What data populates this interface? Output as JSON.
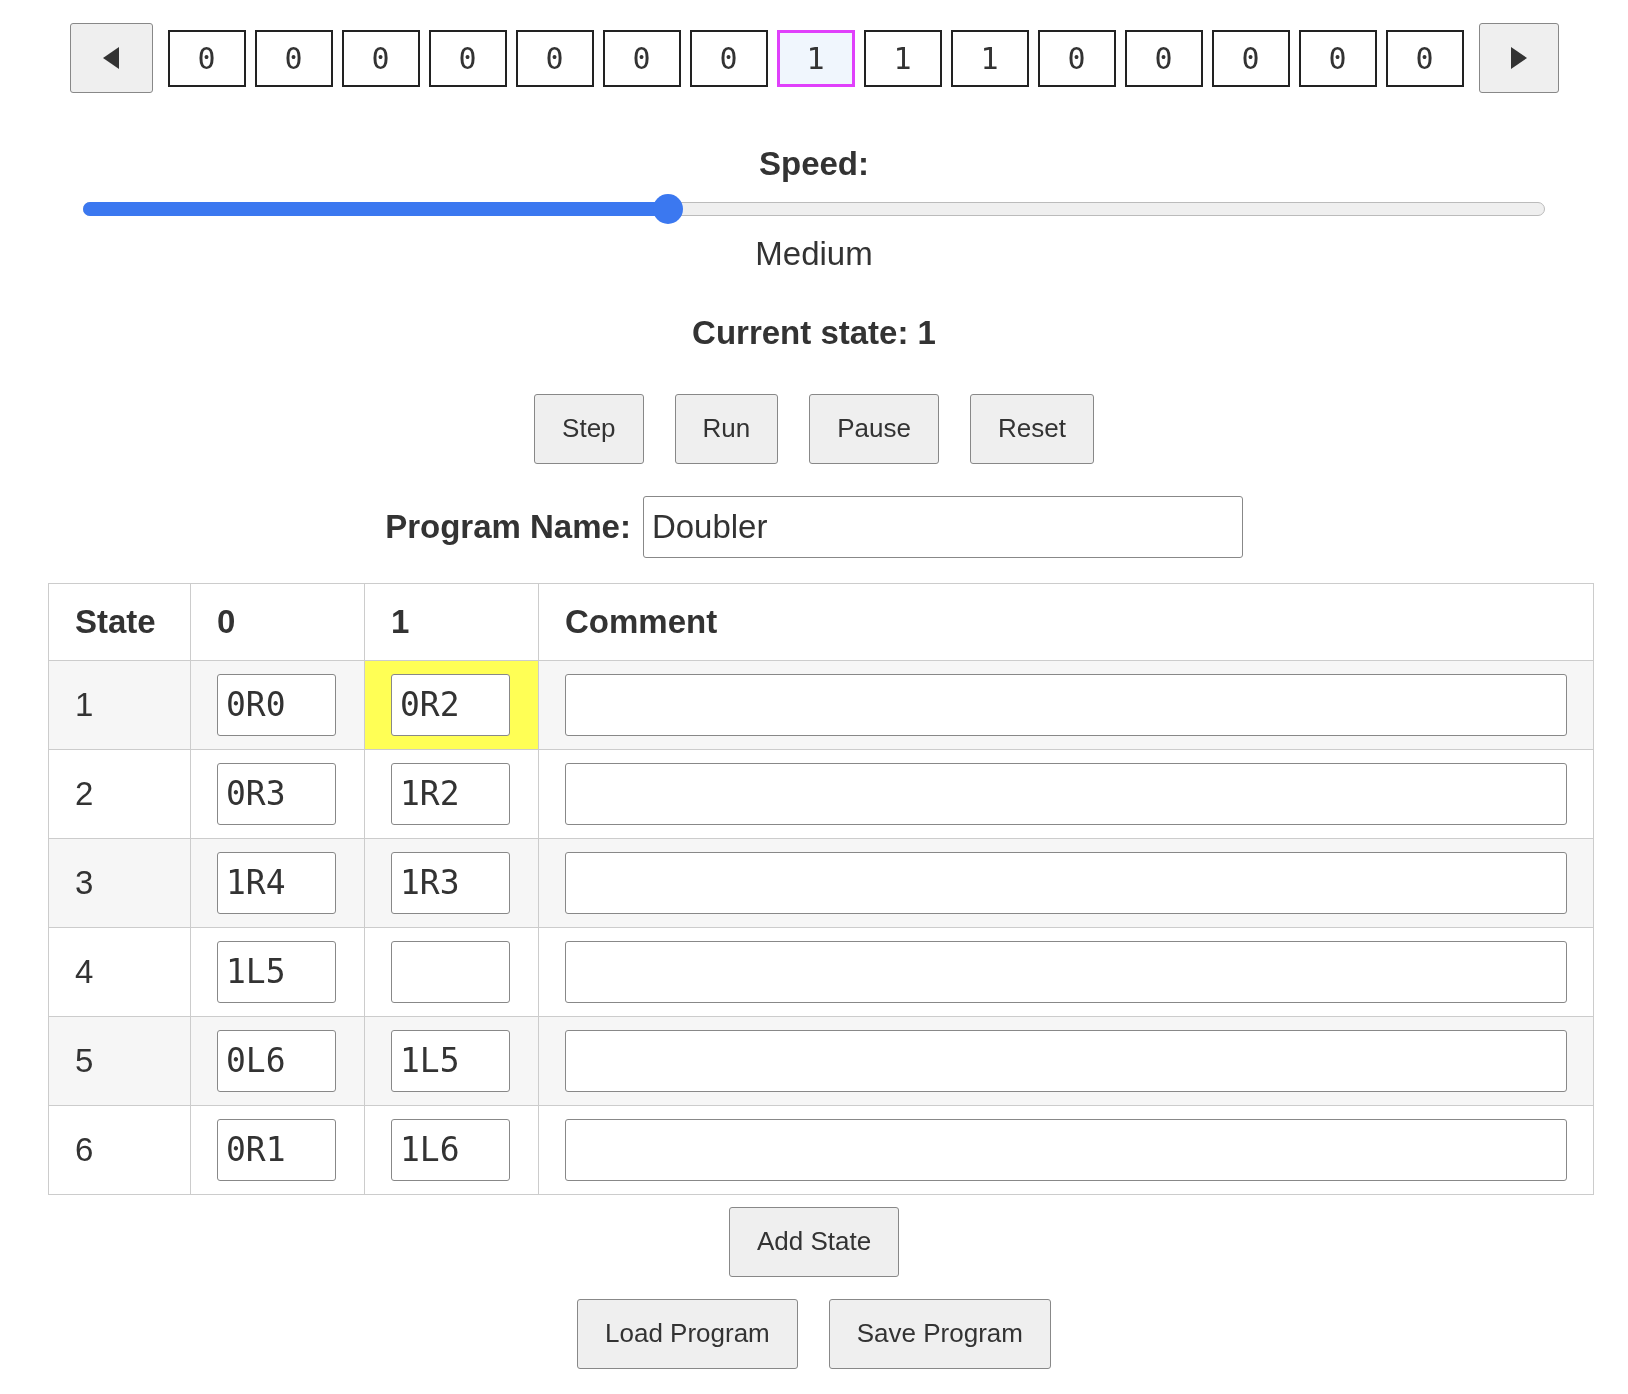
{
  "tape": {
    "cells": [
      {
        "symbol": "0",
        "selected": false
      },
      {
        "symbol": "0",
        "selected": false
      },
      {
        "symbol": "0",
        "selected": false
      },
      {
        "symbol": "0",
        "selected": false
      },
      {
        "symbol": "0",
        "selected": false
      },
      {
        "symbol": "0",
        "selected": false
      },
      {
        "symbol": "0",
        "selected": false
      },
      {
        "symbol": "1",
        "selected": true
      },
      {
        "symbol": "1",
        "selected": false
      },
      {
        "symbol": "1",
        "selected": false
      },
      {
        "symbol": "0",
        "selected": false
      },
      {
        "symbol": "0",
        "selected": false
      },
      {
        "symbol": "0",
        "selected": false
      },
      {
        "symbol": "0",
        "selected": false
      },
      {
        "symbol": "0",
        "selected": false
      }
    ]
  },
  "speed": {
    "label": "Speed:",
    "level": 0.4,
    "reading": "Medium"
  },
  "current_state": "Current state: 1",
  "controls": [
    "Step",
    "Run",
    "Pause",
    "Reset"
  ],
  "program_name": {
    "label": "Program Name:",
    "value": "Doubler"
  },
  "table": {
    "columns": [
      "State",
      "0",
      "1",
      "Comment"
    ],
    "rows": [
      {
        "cells": [
          {
            "kind": "text",
            "text": "1"
          },
          {
            "kind": "field",
            "value": "0R0",
            "highlighted": false
          },
          {
            "kind": "field",
            "value": "0R2",
            "highlighted": true
          },
          {
            "kind": "comment"
          }
        ]
      },
      {
        "cells": [
          {
            "kind": "text",
            "text": "2"
          },
          {
            "kind": "field",
            "value": "0R3",
            "highlighted": false
          },
          {
            "kind": "field",
            "value": "1R2",
            "highlighted": false
          },
          {
            "kind": "comment"
          }
        ]
      },
      {
        "cells": [
          {
            "kind": "text",
            "text": "3"
          },
          {
            "kind": "field",
            "value": "1R4",
            "highlighted": false
          },
          {
            "kind": "field",
            "value": "1R3",
            "highlighted": false
          },
          {
            "kind": "comment"
          }
        ]
      },
      {
        "cells": [
          {
            "kind": "text",
            "text": "4"
          },
          {
            "kind": "field",
            "value": "1L5",
            "highlighted": false
          },
          {
            "kind": "field",
            "highlighted": false
          },
          {
            "kind": "comment"
          }
        ]
      },
      {
        "cells": [
          {
            "kind": "text",
            "text": "5"
          },
          {
            "kind": "field",
            "value": "0L6",
            "highlighted": false
          },
          {
            "kind": "field",
            "value": "1L5",
            "highlighted": false
          },
          {
            "kind": "comment"
          }
        ]
      },
      {
        "cells": [
          {
            "kind": "text",
            "text": "6"
          },
          {
            "kind": "field",
            "value": "0R1",
            "highlighted": false
          },
          {
            "kind": "field",
            "value": "1L6",
            "highlighted": false
          },
          {
            "kind": "comment"
          }
        ]
      }
    ]
  },
  "add_state": "Add State",
  "file_buttons": [
    "Load Program",
    "Save Program"
  ]
}
